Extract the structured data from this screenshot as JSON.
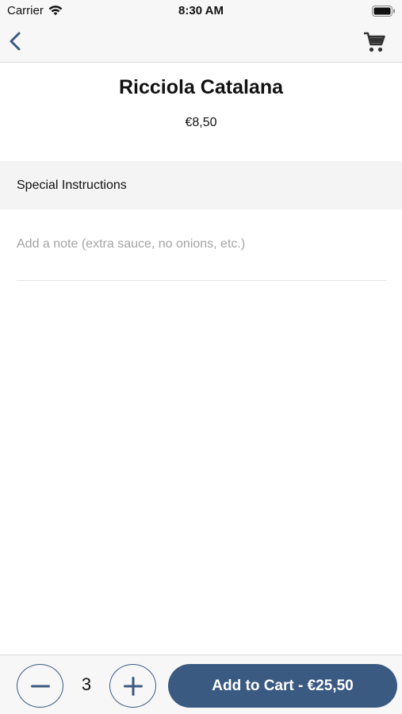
{
  "status_bar": {
    "carrier": "Carrier",
    "time": "8:30 AM",
    "icons": [
      "wifi-icon",
      "battery-icon"
    ]
  },
  "nav": {
    "back_icon": "chevron-left-icon",
    "cart_icon": "cart-icon",
    "accent_color": "#3b5a82"
  },
  "item": {
    "name": "Ricciola Catalana",
    "price": "€8,50"
  },
  "special_instructions": {
    "title": "Special Instructions",
    "placeholder": "Add a note (extra sauce, no onions, etc.)",
    "value": ""
  },
  "cart": {
    "quantity": "3",
    "minus_icon": "minus-icon",
    "plus_icon": "plus-icon",
    "add_label": "Add to Cart - €25,50"
  }
}
